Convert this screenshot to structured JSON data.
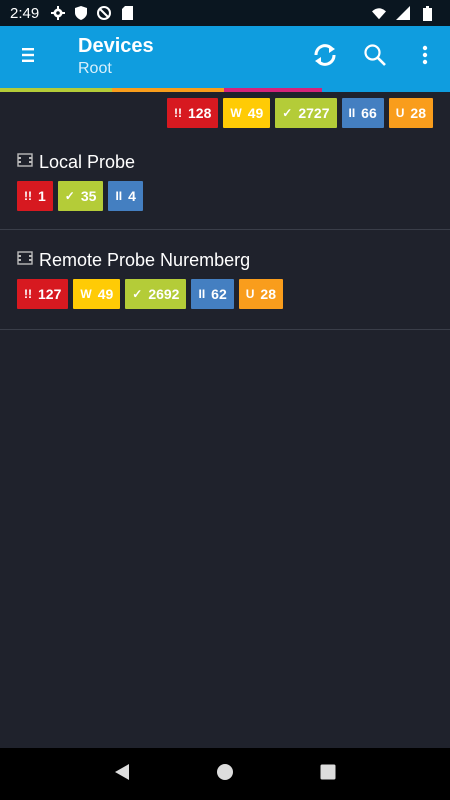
{
  "status_bar": {
    "time": "2:49"
  },
  "app_bar": {
    "title": "Devices",
    "subtitle": "Root"
  },
  "color_strip": [
    "#b4cc38",
    "#f99d1c",
    "#0f9ddf",
    "#d4237a",
    "#0f9ddf"
  ],
  "totals": {
    "down": {
      "symbol": "!!",
      "count": "128"
    },
    "warning": {
      "symbol": "W",
      "count": "49"
    },
    "up": {
      "symbol": "✓",
      "count": "2727"
    },
    "paused": {
      "symbol": "II",
      "count": "66"
    },
    "unusual": {
      "symbol": "U",
      "count": "28"
    }
  },
  "devices": [
    {
      "name": "Local Probe",
      "badges": {
        "down": {
          "symbol": "!!",
          "count": "1"
        },
        "up": {
          "symbol": "✓",
          "count": "35"
        },
        "paused": {
          "symbol": "II",
          "count": "4"
        }
      }
    },
    {
      "name": "Remote Probe Nuremberg",
      "badges": {
        "down": {
          "symbol": "!!",
          "count": "127"
        },
        "warning": {
          "symbol": "W",
          "count": "49"
        },
        "up": {
          "symbol": "✓",
          "count": "2692"
        },
        "paused": {
          "symbol": "II",
          "count": "62"
        },
        "unusual": {
          "symbol": "U",
          "count": "28"
        }
      }
    }
  ],
  "icons": {
    "settings": "gear-icon",
    "shield": "shield-icon",
    "dnd": "do-not-disturb-icon",
    "sd": "sd-card-icon",
    "wifi": "wifi-icon",
    "signal": "signal-icon",
    "battery": "battery-icon",
    "menu": "menu-icon",
    "refresh": "refresh-icon",
    "search": "search-icon",
    "more": "more-vert-icon",
    "device": "device-icon",
    "back": "back-icon",
    "home": "home-icon",
    "recents": "recents-icon"
  }
}
